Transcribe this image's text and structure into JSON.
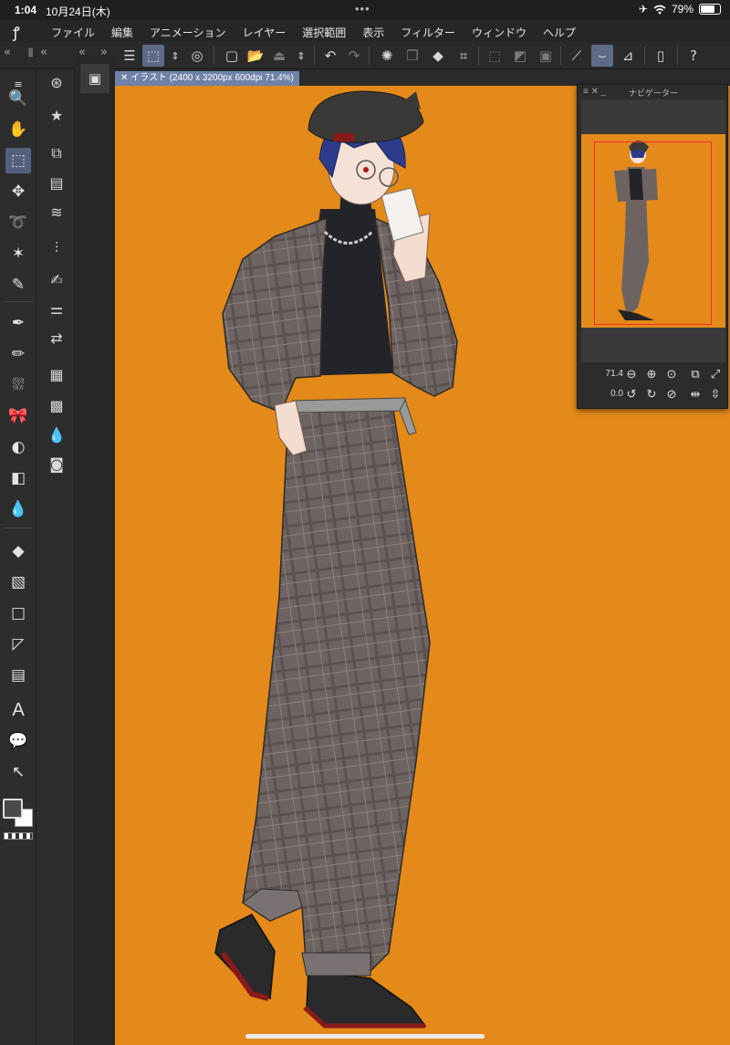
{
  "status": {
    "time": "1:04",
    "date": "10月24日(木)",
    "battery": "79%",
    "battery_level": 0.79
  },
  "menu": {
    "items": [
      "ファイル",
      "編集",
      "アニメーション",
      "レイヤー",
      "選択範囲",
      "表示",
      "フィルター",
      "ウィンドウ",
      "ヘルプ"
    ]
  },
  "canvas": {
    "tab_title": "イラスト (2400 x 3200px 600dpi 71.4%)",
    "background_color": "#e38a1a"
  },
  "navigator": {
    "title": "ナビゲーター",
    "zoom": "71.4",
    "rotation": "0.0"
  },
  "text_tool_label": "A",
  "colors": {
    "accent": "#5e6b87",
    "main_color": "#4a4a4a",
    "sub_color": "#ffffff"
  }
}
